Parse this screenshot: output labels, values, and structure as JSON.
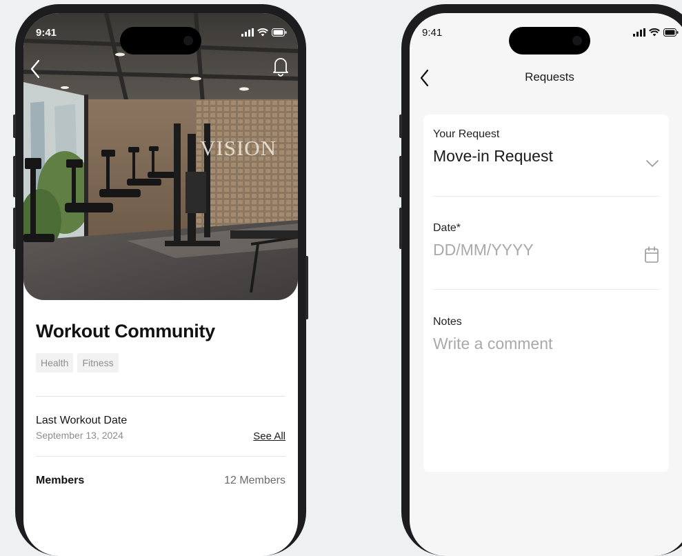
{
  "left_phone": {
    "status_time": "9:41",
    "hero": {
      "sign_text": "VISION"
    },
    "title": "Workout Community",
    "tags": [
      "Health",
      "Fitness"
    ],
    "last_workout": {
      "label": "Last Workout Date",
      "date": "September 13, 2024",
      "see_all": "See All"
    },
    "members": {
      "label": "Members",
      "count": "12 Members"
    }
  },
  "right_phone": {
    "status_time": "9:41",
    "nav_title": "Requests",
    "form": {
      "request": {
        "label": "Your Request",
        "value": "Move-in Request"
      },
      "date": {
        "label": "Date*",
        "placeholder": "DD/MM/YYYY"
      },
      "notes": {
        "label": "Notes",
        "placeholder": "Write a comment"
      }
    }
  },
  "icons": {
    "back": "chevron-left-icon",
    "notification": "bell-icon",
    "dropdown": "chevron-down-icon",
    "calendar": "calendar-icon",
    "signal": "cellular-signal-icon",
    "wifi": "wifi-icon",
    "battery": "battery-icon"
  },
  "colors": {
    "page_background": "#eef0f1",
    "phone_frame": "#1d1d1f",
    "form_background": "#f6f6f7",
    "placeholder_text": "#a9a9a9",
    "tag_background": "#f2f2f2"
  }
}
